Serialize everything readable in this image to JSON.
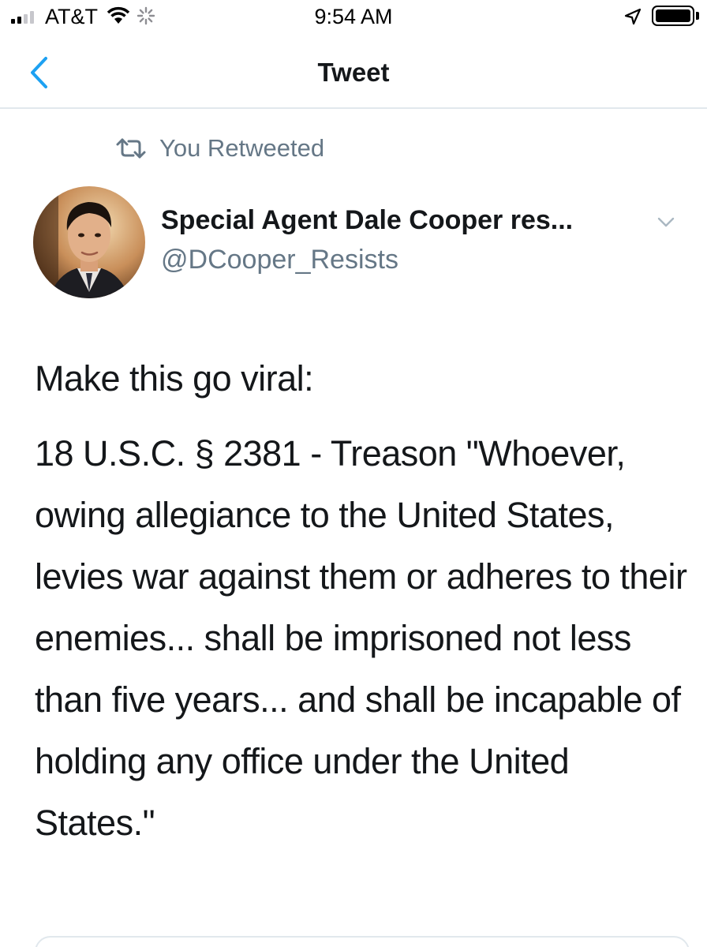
{
  "status_bar": {
    "carrier": "AT&T",
    "time": "9:54 AM",
    "signal_bars_filled": 2,
    "signal_bars_total": 4,
    "battery_level": 1.0,
    "icons": [
      "signal-icon",
      "wifi-icon",
      "activity-spinner-icon",
      "location-arrow-icon",
      "battery-icon"
    ]
  },
  "nav": {
    "title": "Tweet",
    "back_icon": "chevron-left-icon"
  },
  "tweet": {
    "retweet_label": "You Retweeted",
    "author": {
      "display_name": "Special Agent Dale Cooper res...",
      "handle": "@DCooper_Resists"
    },
    "text_intro": "Make this go viral:",
    "text_body": "18 U.S.C. § 2381 - Treason \"Whoever, owing allegiance to the United States, levies war against them or adheres to their enemies... shall be imprisoned not less than five years... and shall be incapable of holding any office under the United States.\""
  },
  "colors": {
    "accent": "#1da1f2",
    "text_primary": "#14171a",
    "text_secondary": "#657786",
    "divider": "#e1e8ed"
  }
}
